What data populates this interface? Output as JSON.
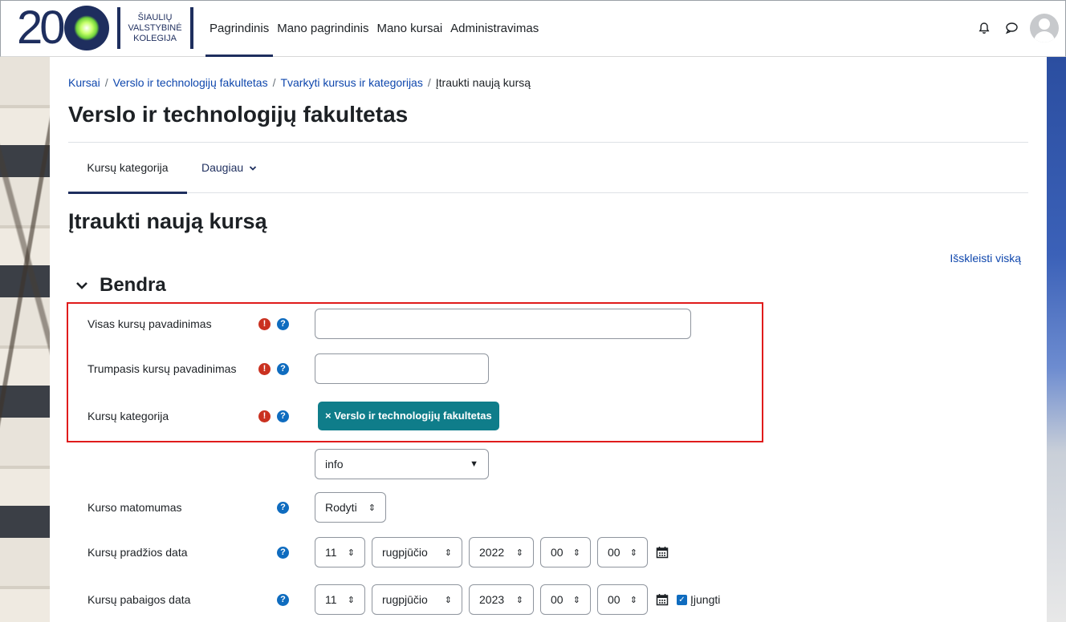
{
  "logo": {
    "number": "20",
    "line1": "ŠIAULIŲ",
    "line2": "VALSTYBINĖ",
    "line3": "KOLEGIJA"
  },
  "nav": {
    "items": [
      "Pagrindinis",
      "Mano pagrindinis",
      "Mano kursai",
      "Administravimas"
    ]
  },
  "icons": {
    "notifications": "bell-icon",
    "messages": "chat-icon",
    "user": "avatar"
  },
  "breadcrumb": [
    "Kursai",
    "Verslo ir technologijų fakultetas",
    "Tvarkyti kursus ir kategorijas",
    "Įtraukti naują kursą"
  ],
  "page_title": "Verslo ir technologijų fakultetas",
  "secondary_nav": {
    "tab1": "Kursų kategorija",
    "tab2": "Daugiau"
  },
  "heading": "Įtraukti naują kursą",
  "expand_all": "Išskleisti viską",
  "section": "Bendra",
  "form": {
    "fullname_label": "Visas kursų pavadinimas",
    "fullname_value": "",
    "shortname_label": "Trumpasis kursų pavadinimas",
    "shortname_value": "",
    "category_label": "Kursų kategorija",
    "category_value": "× Verslo ir technologijų fakultetas",
    "category_search": "info",
    "visibility_label": "Kurso matomumas",
    "visibility_value": "Rodyti",
    "start_label": "Kursų pradžios data",
    "start": {
      "day": "11",
      "month": "rugpjūčio",
      "year": "2022",
      "hour": "00",
      "minute": "00"
    },
    "end_label": "Kursų pabaigos data",
    "end": {
      "day": "11",
      "month": "rugpjūčio",
      "year": "2023",
      "hour": "00",
      "minute": "00",
      "enable_label": "Įjungti",
      "enabled": true
    }
  },
  "colors": {
    "brand": "#1e2e5e",
    "link": "#0f47ad",
    "required": "#ca3120",
    "help": "#0f6cbf",
    "badge": "#0f7d8a",
    "highlight": "#e01b1b"
  }
}
